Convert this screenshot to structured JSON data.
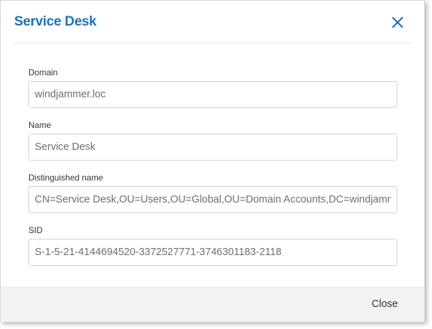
{
  "dialog": {
    "title": "Service Desk",
    "close_icon": "close-x-icon",
    "accent_color": "#1f6fba"
  },
  "fields": [
    {
      "label": "Domain",
      "value": "windjammer.loc"
    },
    {
      "label": "Name",
      "value": "Service Desk"
    },
    {
      "label": "Distinguished name",
      "value": "CN=Service Desk,OU=Users,OU=Global,OU=Domain Accounts,DC=windjammer,DC=loc"
    },
    {
      "label": "SID",
      "value": "S-1-5-21-4144694520-3372527771-3746301183-2118"
    }
  ],
  "footer": {
    "close_label": "Close"
  }
}
